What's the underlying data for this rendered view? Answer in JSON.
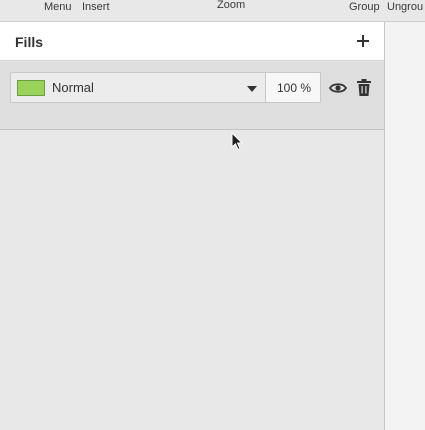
{
  "toolbar": {
    "menu_label": "Menu",
    "insert_label": "Insert",
    "zoom_label": "Zoom",
    "group_label": "Group",
    "ungroup_label": "Ungrou"
  },
  "fills_panel": {
    "title": "Fills",
    "add_icon": "plus-icon",
    "fill": {
      "swatch_color": "#99d35c",
      "blend_mode": "Normal",
      "opacity": "100 %",
      "visibility_icon": "eye-icon",
      "delete_icon": "trash-icon"
    }
  }
}
